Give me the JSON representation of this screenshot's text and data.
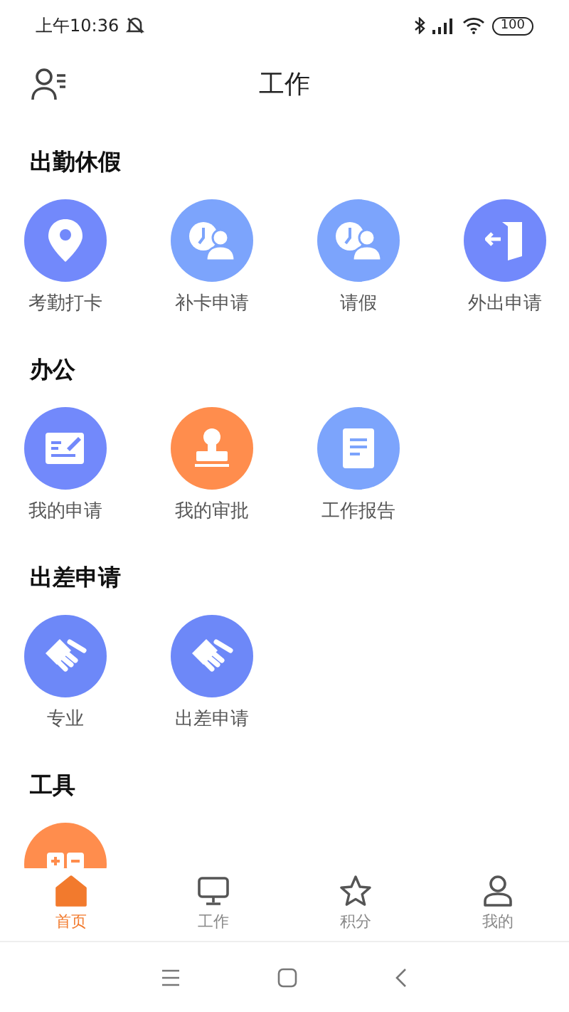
{
  "status_bar": {
    "time": "上午10:36",
    "battery": "100"
  },
  "header": {
    "title": "工作"
  },
  "sections": [
    {
      "title": "出勤休假",
      "items": [
        {
          "label": "考勤打卡",
          "kind": "pin",
          "color": "#7289fb"
        },
        {
          "label": "补卡申请",
          "kind": "clock-person",
          "color": "#7ca4fc"
        },
        {
          "label": "请假",
          "kind": "clock-person",
          "color": "#7ca4fc"
        },
        {
          "label": "外出申请",
          "kind": "exit",
          "color": "#7289fb"
        }
      ]
    },
    {
      "title": "办公",
      "items": [
        {
          "label": "我的申请",
          "kind": "form",
          "color": "#7289fb"
        },
        {
          "label": "我的审批",
          "kind": "stamp",
          "color": "#ff8d4d"
        },
        {
          "label": "工作报告",
          "kind": "doc",
          "color": "#7ca4fc"
        }
      ]
    },
    {
      "title": "出差申请",
      "items": [
        {
          "label": "专业",
          "kind": "handshake",
          "color": "#6d88f8"
        },
        {
          "label": "出差申请",
          "kind": "handshake",
          "color": "#6d88f8"
        }
      ]
    },
    {
      "title": "工具",
      "items": [
        {
          "kind": "calc",
          "color": "#ff8d4d"
        }
      ]
    }
  ],
  "tabs": [
    {
      "label": "首页",
      "kind": "home",
      "selected": true
    },
    {
      "label": "工作",
      "kind": "monitor",
      "selected": false
    },
    {
      "label": "积分",
      "kind": "star",
      "selected": false
    },
    {
      "label": "我的",
      "kind": "user",
      "selected": false
    }
  ]
}
